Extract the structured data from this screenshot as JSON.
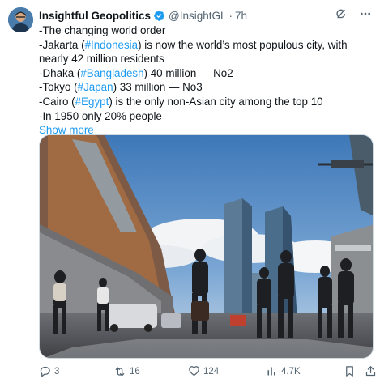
{
  "author": {
    "display_name": "Insightful Geopolitics",
    "handle": "@InsightGL",
    "separator": "·",
    "time": "7h"
  },
  "icons": {
    "avatar": "avatar-photo",
    "verified": "verified-badge-icon",
    "grok": "grok-icon",
    "more": "more-options-icon",
    "reply": "reply-icon",
    "retweet": "retweet-icon",
    "like": "heart-icon",
    "views": "views-chart-icon",
    "bookmark": "bookmark-icon",
    "share": "share-icon"
  },
  "colors": {
    "link": "#1d9bf0",
    "text": "#0f1419",
    "muted": "#536471",
    "verified": "#1d9bf0"
  },
  "post": {
    "line1": "-The changing world order",
    "line2": {
      "before": "-Jakarta (",
      "tag": "#Indonesia",
      "after": ") is now the world’s most populous city, with nearly 42 million residents"
    },
    "line3": {
      "before": "-Dhaka (",
      "tag": "#Bangladesh",
      "after": ") 40 million — No2"
    },
    "line4": {
      "before": "-Tokyo (",
      "tag": "#Japan",
      "after": ") 33 million — No3"
    },
    "line5": {
      "before": "-Cairo (",
      "tag": "#Egypt",
      "after": ") is the only non-Asian city among the top 10"
    },
    "line6": "-In 1950 only 20% people",
    "show_more": "Show more"
  },
  "metrics": {
    "replies": "3",
    "reposts": "16",
    "likes": "124",
    "views": "4.7K"
  }
}
